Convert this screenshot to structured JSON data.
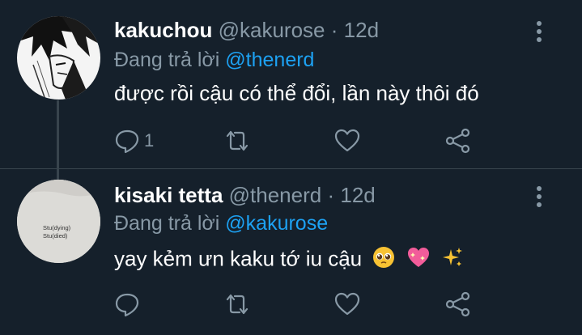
{
  "tweets": [
    {
      "name": "kakuchou",
      "handle": "@kakurose",
      "separator": "·",
      "time": "12d",
      "reply_prefix": "Đang trả lời",
      "reply_to": "@thenerd",
      "text": "được rồi cậu có thể đổi, lần này thôi đó",
      "reply_count": "1",
      "avatar_icon": "manga-character-avatar"
    },
    {
      "name": "kisaki tetta",
      "handle": "@thenerd",
      "separator": "·",
      "time": "12d",
      "reply_prefix": "Đang trả lời",
      "reply_to": "@kakurose",
      "text": "yay kẻm ưn kaku tớ iu cậu",
      "avatar_text_line1": "Stu(dying)",
      "avatar_text_line2": "Stu(died)",
      "emojis": [
        "pleading-face-emoji",
        "sparkling-heart-emoji",
        "sparkles-emoji"
      ]
    }
  ],
  "colors": {
    "background": "#15202b",
    "secondary_text": "#8899a6",
    "link": "#1da1f2",
    "divider": "#38444d"
  }
}
